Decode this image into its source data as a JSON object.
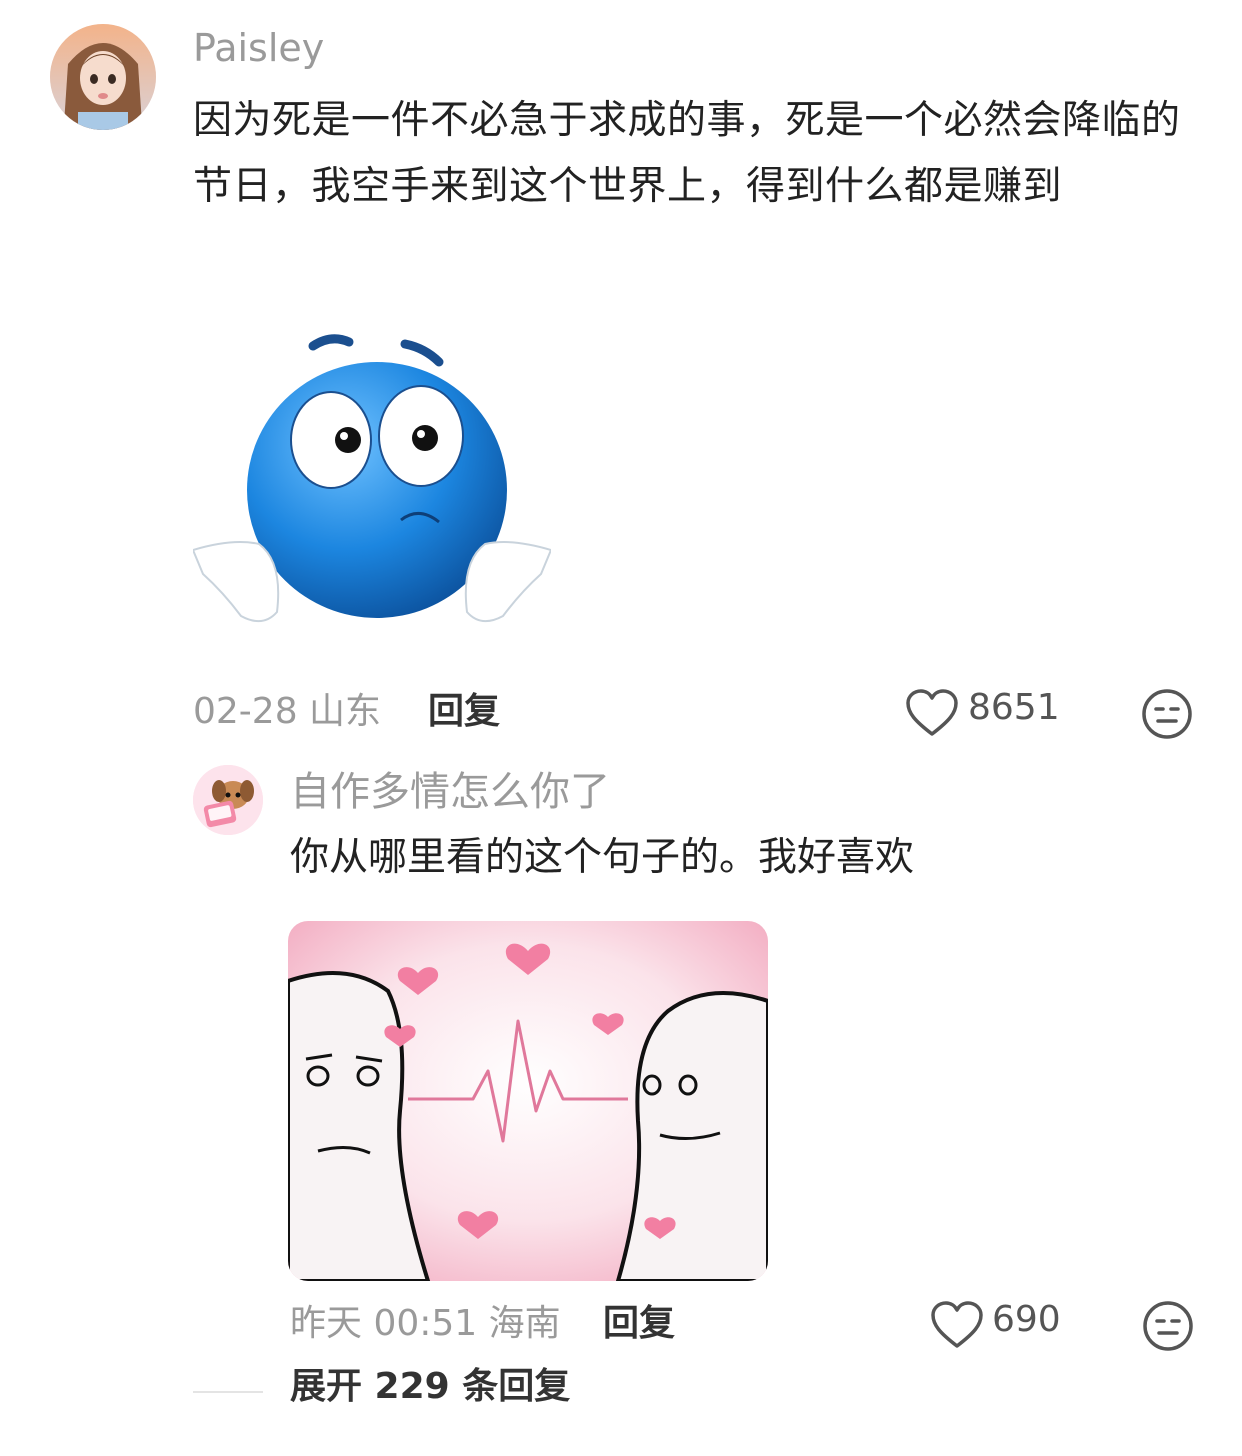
{
  "top_comment": {
    "username": "Paisley",
    "text": "因为死是一件不必急于求成的事，死是一个必然会降临的节日，我空手来到这个世界上，得到什么都是赚到",
    "date_location": "02-28 山东",
    "reply_label": "回复",
    "likes": "8651",
    "avatar_icon": "girl-avatar",
    "sticker_icon": "blue-shrug-emoji"
  },
  "reply_comment": {
    "username": "自作多情怎么你了",
    "text": "你从哪里看的这个句子的。我好喜欢",
    "date_location": "昨天 00:51 海南",
    "reply_label": "回复",
    "likes": "690",
    "avatar_icon": "puppy-avatar",
    "meme_icon": "heartbeat-meme"
  },
  "expand_replies": "展开 229 条回复",
  "colors": {
    "text_primary": "#222222",
    "text_secondary": "#9a9a9a",
    "background": "#ffffff",
    "emoji_blue": "#1f7fd6",
    "meme_pink": "#f4b6c6"
  }
}
